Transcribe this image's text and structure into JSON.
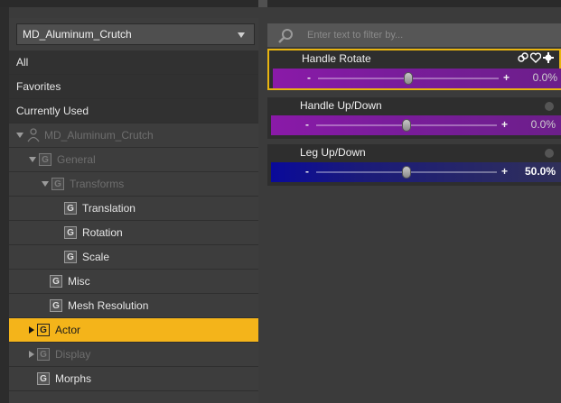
{
  "left_panel": {
    "dropdown_value": "MD_Aluminum_Crutch",
    "tree": [
      {
        "label": "All",
        "level": 0,
        "style": "dark",
        "type": "plain"
      },
      {
        "label": "Favorites",
        "level": 0,
        "style": "dark",
        "type": "plain"
      },
      {
        "label": "Currently Used",
        "level": 0,
        "style": "dark",
        "type": "plain"
      },
      {
        "label": "MD_Aluminum_Crutch",
        "level": 0,
        "style": "dim",
        "type": "figure",
        "expander": "expanded"
      },
      {
        "label": "General",
        "level": 1,
        "style": "dim",
        "type": "group",
        "expander": "expanded"
      },
      {
        "label": "Transforms",
        "level": 2,
        "style": "dim",
        "type": "group",
        "expander": "expanded"
      },
      {
        "label": "Translation",
        "level": 3,
        "style": "normal",
        "type": "group"
      },
      {
        "label": "Rotation",
        "level": 3,
        "style": "normal",
        "type": "group"
      },
      {
        "label": "Scale",
        "level": 3,
        "style": "normal",
        "type": "group"
      },
      {
        "label": "Misc",
        "level": 2,
        "style": "normal",
        "type": "group"
      },
      {
        "label": "Mesh Resolution",
        "level": 2,
        "style": "normal",
        "type": "group"
      },
      {
        "label": "Actor",
        "level": 1,
        "style": "selected",
        "type": "group",
        "expander": "collapsed"
      },
      {
        "label": "Display",
        "level": 1,
        "style": "dim",
        "type": "group",
        "expander": "collapsed"
      },
      {
        "label": "Morphs",
        "level": 1,
        "style": "normal",
        "type": "group"
      }
    ]
  },
  "right_panel": {
    "search_placeholder": "Enter text to filter by...",
    "parameters": [
      {
        "title": "Handle Rotate",
        "value": "0.0%",
        "slider_fraction": 0.5,
        "color": "purple",
        "active": true
      },
      {
        "title": "Handle Up/Down",
        "value": "0.0%",
        "slider_fraction": 0.5,
        "color": "purple",
        "active": false
      },
      {
        "title": "Leg Up/Down",
        "value": "50.0%",
        "slider_fraction": 0.5,
        "color": "blue",
        "active": false
      }
    ],
    "slider_minus": "-",
    "slider_plus": "+",
    "group_glyph": "G"
  },
  "colors": {
    "selection": "#f4b41a",
    "active_border": "#e8b410",
    "purple_bar": "#8a1aa8",
    "blue_bar": "#0a0a9a"
  }
}
